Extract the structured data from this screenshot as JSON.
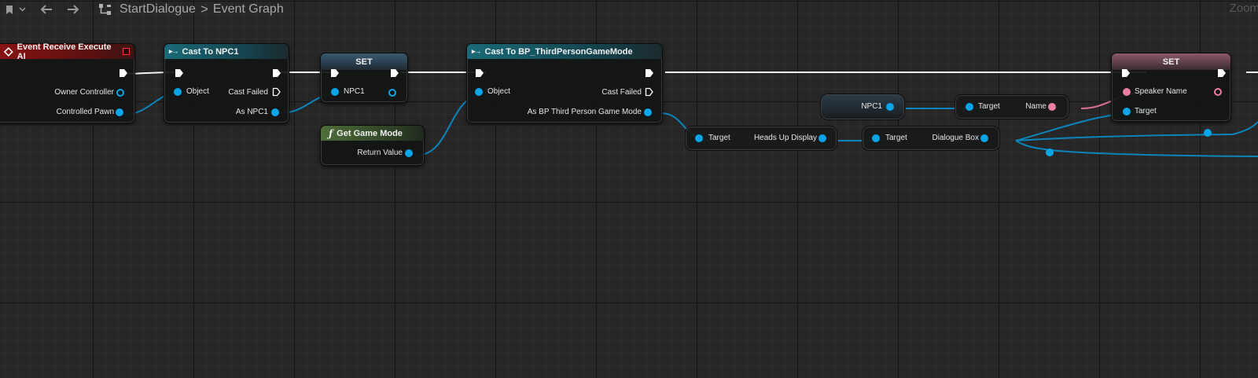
{
  "toolbar": {
    "breadcrumb_root": "StartDialogue",
    "breadcrumb_separator": ">",
    "breadcrumb_current": "Event Graph",
    "zoom_label": "Zoom"
  },
  "colors": {
    "background": "#262626",
    "event_header": "#8a1414",
    "cast_header": "#1a6a78",
    "function_header": "#4e6e3a",
    "object_pin": "#0aa6e8",
    "string_pin": "#ea7ea0",
    "exec_wire": "#ffffff"
  },
  "nodes": {
    "event": {
      "title": "Event Receive Execute AI",
      "pins": [
        "Owner Controller",
        "Controlled Pawn"
      ]
    },
    "cast_npc1": {
      "title": "Cast To NPC1",
      "input": "Object",
      "cast_failed": "Cast Failed",
      "output": "As NPC1"
    },
    "set_npc1": {
      "title": "SET",
      "pin": "NPC1"
    },
    "get_game_mode": {
      "icon": "function-icon",
      "icon_glyph": "ƒ",
      "title": "Get Game Mode",
      "output": "Return Value"
    },
    "cast_gamemode": {
      "title": "Cast To BP_ThirdPersonGameMode",
      "input": "Object",
      "cast_failed": "Cast Failed",
      "output": "As BP Third Person Game Mode"
    },
    "heads_up": {
      "input": "Target",
      "output": "Heads Up Display"
    },
    "dialogue_box": {
      "input": "Target",
      "output": "Dialogue Box"
    },
    "npc1_var": {
      "label": "NPC1"
    },
    "get_name": {
      "input": "Target",
      "output": "Name"
    },
    "set_speaker": {
      "title": "SET",
      "pin_speaker": "Speaker Name",
      "pin_target": "Target"
    }
  }
}
